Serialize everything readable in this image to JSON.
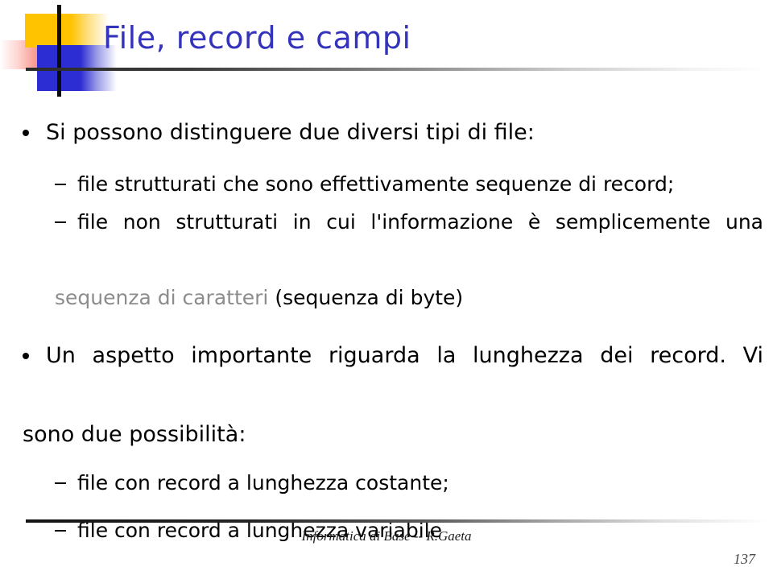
{
  "slide": {
    "title": "File, record e campi",
    "title_color": "#3333bb",
    "background_color": "#ffffff",
    "body_color": "#000000",
    "accent_gray": "#8c8c8c"
  },
  "logo": {
    "yellow": "#ffc300",
    "blue": "#2d2dd4",
    "red": "#f62d18",
    "bar": "#0b0b0b"
  },
  "content": {
    "bullet1": {
      "text": "Si possono distinguere due diversi tipi di file:"
    },
    "sub1": {
      "text": "file strutturati che sono effettivamente sequenze di record;"
    },
    "sub2": {
      "line1": "file non strutturati in cui l'informazione è semplicemente una",
      "line2_gray": "sequenza di caratteri",
      "line2_black": " (sequenza di byte)"
    },
    "bullet2": {
      "line1": "Un aspetto importante riguarda la lunghezza dei record. Vi",
      "line2": "sono due possibilità:"
    },
    "sub3": {
      "text": "file con record a lunghezza costante;"
    },
    "sub4": {
      "text": "file con record a lunghezza variabile"
    }
  },
  "footer": {
    "credit": "Informatica di Base -- R.Gaeta",
    "page_number": "137"
  }
}
